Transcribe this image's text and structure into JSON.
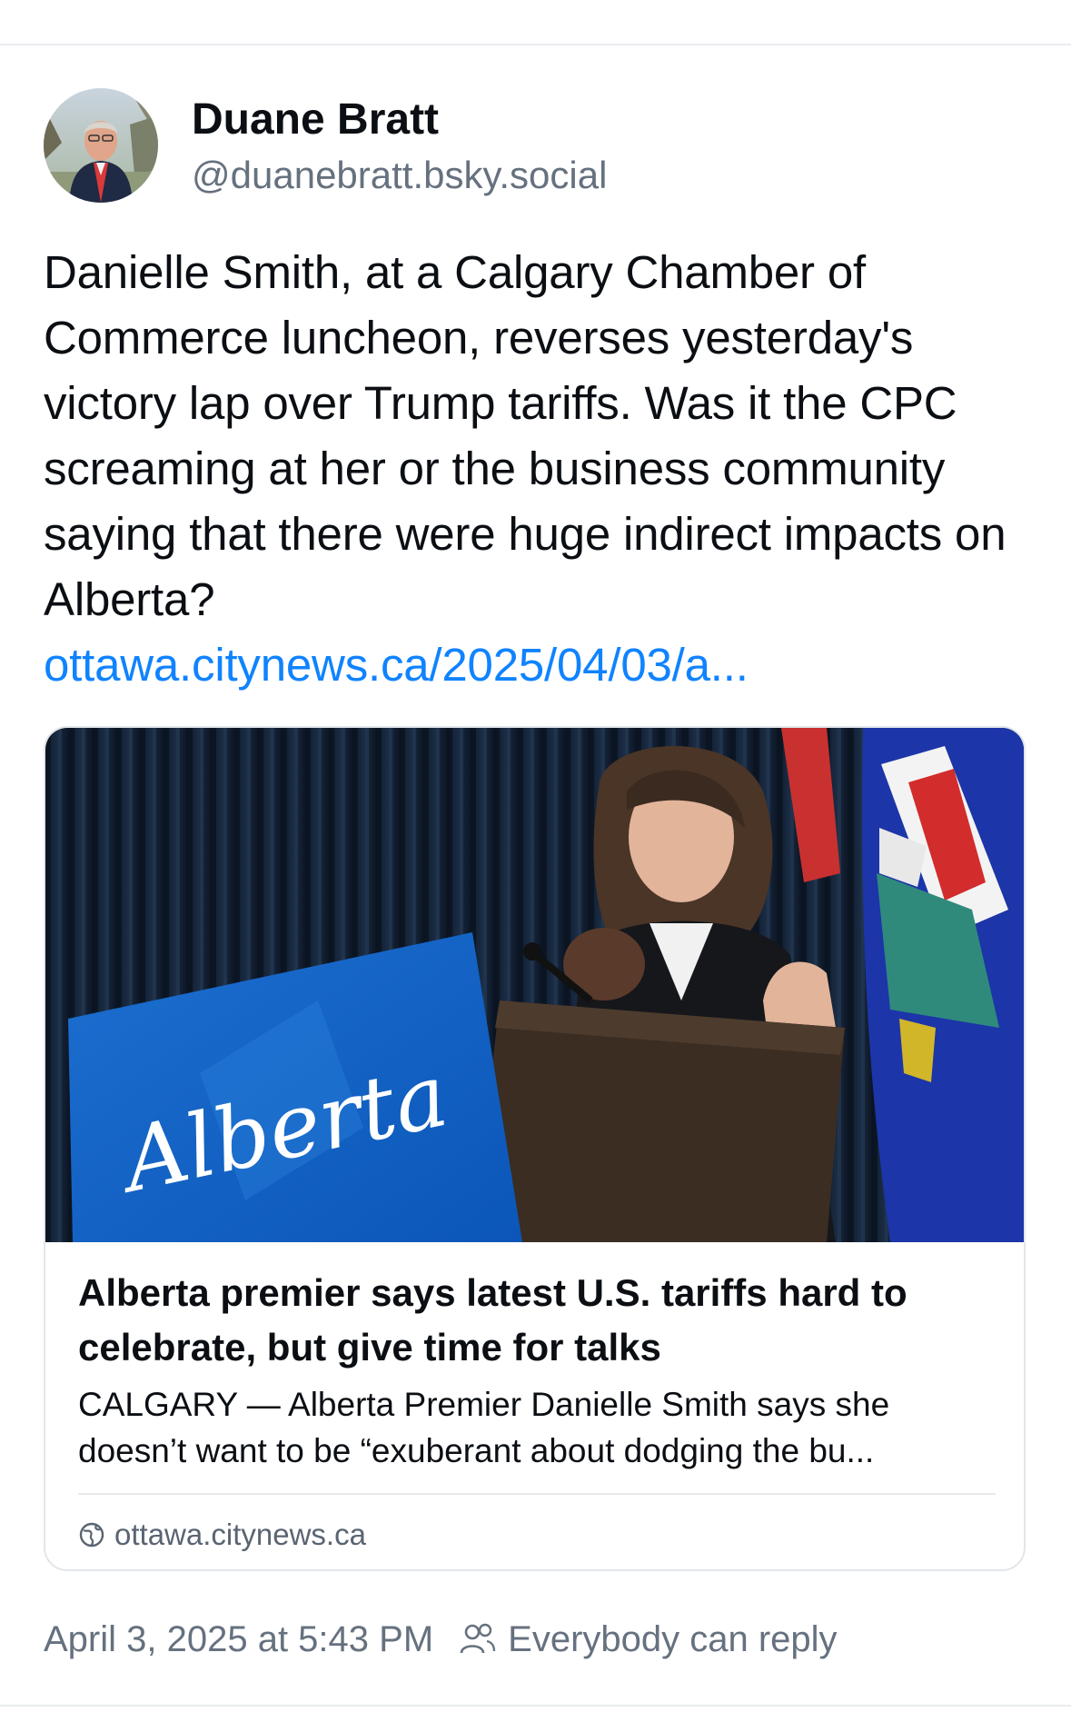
{
  "author": {
    "display_name": "Duane Bratt",
    "handle": "@duanebratt.bsky.social",
    "avatar_icon": "profile-photo"
  },
  "post": {
    "text": "Danielle Smith, at a Calgary Chamber of Commerce luncheon, reverses yesterday's victory lap over Trump tariffs. Was it the CPC screaming at her or the business community saying that there were huge indirect impacts on Alberta?",
    "link_text": "ottawa.citynews.ca/2025/04/03/a...",
    "link_color": "#1083fe"
  },
  "link_card": {
    "image_sign_text": "Alberta",
    "title": "Alberta premier says latest U.S. tariffs hard to celebrate, but give time for talks",
    "description": "CALGARY — Alberta Premier Danielle Smith says she doesn’t want to be “exuberant about dodging the bu...",
    "domain": "ottawa.citynews.ca",
    "domain_icon": "globe-icon"
  },
  "meta": {
    "timestamp": "April 3, 2025 at 5:43 PM",
    "reply_setting": "Everybody can reply",
    "reply_icon": "people-icon"
  },
  "colors": {
    "text_primary": "#0b0f14",
    "text_secondary": "#66717f",
    "divider": "#e9ecef"
  }
}
